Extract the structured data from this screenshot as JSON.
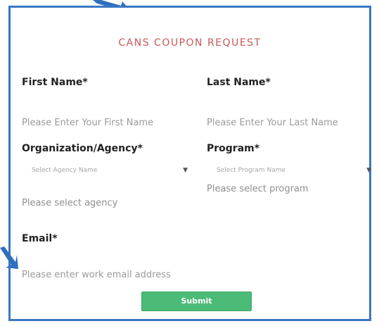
{
  "form": {
    "title": "CANS COUPON REQUEST",
    "first_name": {
      "label": "First Name*",
      "placeholder": "Please Enter Your First Name"
    },
    "last_name": {
      "label": "Last Name*",
      "placeholder": "Please Enter Your Last Name"
    },
    "organization": {
      "label": "Organization/Agency*",
      "selected": "Select Agency Name",
      "error": "Please select agency"
    },
    "program": {
      "label": "Program*",
      "selected": "Select Program Name",
      "error": "Please select program"
    },
    "email": {
      "label": "Email*",
      "placeholder": "Please enter work email address"
    },
    "submit_label": "Submit"
  },
  "colors": {
    "border": "#3a78c4",
    "title": "#c8585c",
    "submit": "#4cbb78"
  }
}
